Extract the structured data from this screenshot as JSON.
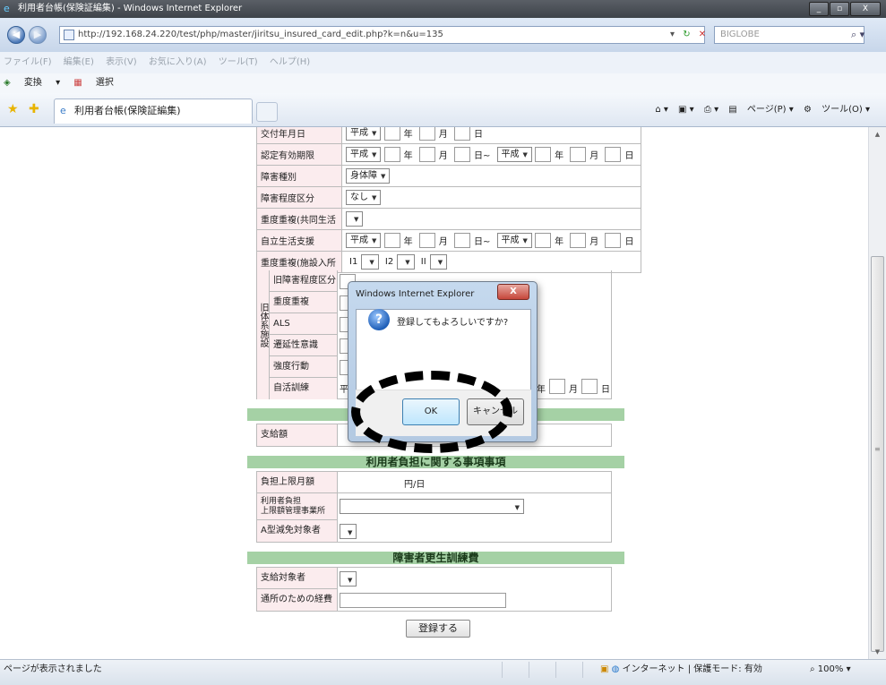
{
  "window": {
    "title": "利用者台帳(保険証編集) - Windows Internet Explorer",
    "minimize": "_",
    "maximize": "▫",
    "close": "X"
  },
  "addressbar": {
    "url": "http://192.168.24.220/test/php/master/jiritsu_insured_card_edit.php?k=n&u=135",
    "search_text": "BIGLOBE"
  },
  "menubar": [
    "ファイル(F)",
    "編集(E)",
    "表示(V)",
    "お気に入り(A)",
    "ツール(T)",
    "ヘルプ(H)"
  ],
  "linkbar": [
    "変換",
    "選択"
  ],
  "tab": {
    "title": "利用者台帳(保険証編集)"
  },
  "commandbar": {
    "page": "ページ(P)",
    "tools": "ツール(O)"
  },
  "form": {
    "rows": [
      {
        "label": "交付年月日",
        "era": "平成"
      },
      {
        "label": "認定有効期限",
        "era": "平成",
        "era2": "平成"
      },
      {
        "label": "障害種別",
        "value": "身体障"
      },
      {
        "label": "障害程度区分",
        "value": "なし"
      },
      {
        "label": "重度重複(共同生活",
        "value": ""
      },
      {
        "label": "自立生活支援",
        "era": "平成",
        "era2": "平成"
      },
      {
        "label": "重度重複(施設入所",
        "i1": "I1",
        "i2": "I2",
        "ii": "II"
      }
    ],
    "old_system": {
      "group_label": "旧体系施設",
      "rows": [
        "旧障害程度区分",
        "重度重複",
        "ALS",
        "遷延性意識",
        "強度行動",
        "自活訓練"
      ],
      "era": "平"
    },
    "units": {
      "year": "年",
      "month": "月",
      "day": "日",
      "tilde": "日~"
    },
    "payment_label": "支給額",
    "section_burden": "利用者負担に関する事項事項",
    "burden_limit_label": "負担上限月額",
    "burden_limit_value": "円/日",
    "burden_manager_label_1": "利用者負担",
    "burden_manager_label_2": "上限額管理事業所",
    "reduction_label": "A型減免対象者",
    "section_rehab": "障害者更生訓練費",
    "rehab_target_label": "支給対象者",
    "commute_label": "通所のための経費",
    "submit": "登録する"
  },
  "dialog": {
    "title": "Windows Internet Explorer",
    "message": "登録してもよろしいですか?",
    "ok": "OK",
    "cancel": "キャンセル",
    "close": "X"
  },
  "statusbar": {
    "text": "ページが表示されました",
    "zone": "インターネット | 保護モード: 有効",
    "zoom": "100%"
  }
}
